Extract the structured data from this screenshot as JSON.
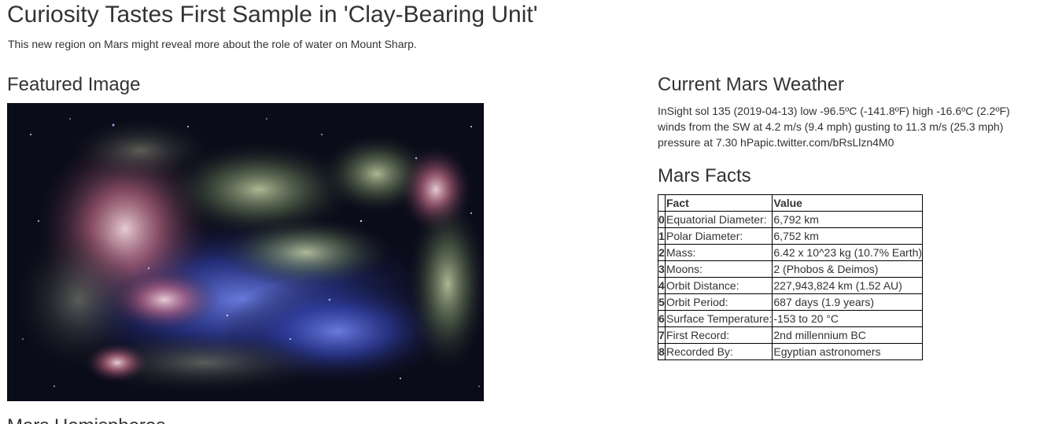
{
  "news": {
    "title": "Curiosity Tastes First Sample in 'Clay-Bearing Unit'",
    "teaser": "This new region on Mars might reveal more about the role of water on Mount Sharp."
  },
  "featured": {
    "heading": "Featured Image",
    "image_icon": "galaxy-image"
  },
  "weather": {
    "heading": "Current Mars Weather",
    "text": "InSight sol 135 (2019-04-13) low -96.5ºC (-141.8ºF) high -16.6ºC (2.2ºF) winds from the SW at 4.2 m/s (9.4 mph) gusting to 11.3 m/s (25.3 mph) pressure at 7.30 hPapic.twitter.com/bRsLlzn4M0"
  },
  "facts": {
    "heading": "Mars Facts",
    "columns": [
      "",
      "Fact",
      "Value"
    ],
    "rows": [
      {
        "index": "0",
        "fact": "Equatorial Diameter:",
        "value": "6,792 km"
      },
      {
        "index": "1",
        "fact": "Polar Diameter:",
        "value": "6,752 km"
      },
      {
        "index": "2",
        "fact": "Mass:",
        "value": "6.42 x 10^23 kg (10.7% Earth)"
      },
      {
        "index": "3",
        "fact": "Moons:",
        "value": "2 (Phobos & Deimos)"
      },
      {
        "index": "4",
        "fact": "Orbit Distance:",
        "value": "227,943,824 km (1.52 AU)"
      },
      {
        "index": "5",
        "fact": "Orbit Period:",
        "value": "687 days (1.9 years)"
      },
      {
        "index": "6",
        "fact": "Surface Temperature:",
        "value": "-153 to 20 °C"
      },
      {
        "index": "7",
        "fact": "First Record:",
        "value": "2nd millennium BC"
      },
      {
        "index": "8",
        "fact": "Recorded By:",
        "value": "Egyptian astronomers"
      }
    ]
  },
  "hemispheres": {
    "heading": "Mars Hemispheres"
  }
}
